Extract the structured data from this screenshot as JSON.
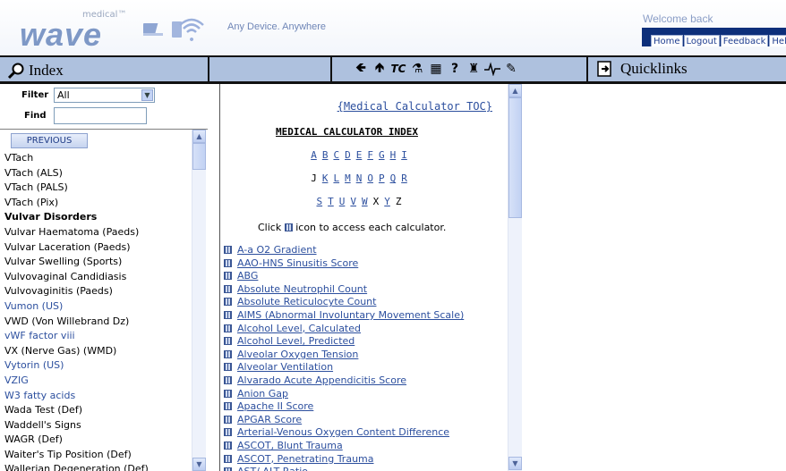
{
  "header": {
    "logo_small": "medical™",
    "logo_main": "wave",
    "tagline": "Any Device. Anywhere",
    "welcome": "Welcome back",
    "links": [
      "Home",
      "Logout",
      "Feedback",
      "Help"
    ]
  },
  "bar": {
    "index_title": "Index",
    "quicklinks_title": "Quicklinks",
    "toolbar_icons": [
      "back-arrow-icon",
      "up-arrow-icon",
      "tc-icon",
      "flask-icon",
      "calculator-icon",
      "help-icon",
      "chess-piece-icon",
      "heartbeat-icon",
      "pencil-icon"
    ]
  },
  "filter": {
    "filter_label": "Filter",
    "filter_value": "All",
    "find_label": "Find",
    "find_value": ""
  },
  "list": {
    "previous_label": "PREVIOUS",
    "items": [
      {
        "text": "VTach",
        "style": "normal"
      },
      {
        "text": "VTach (ALS)",
        "style": "normal"
      },
      {
        "text": "VTach (PALS)",
        "style": "normal"
      },
      {
        "text": "VTach (Pix)",
        "style": "normal"
      },
      {
        "text": "Vulvar Disorders",
        "style": "bold"
      },
      {
        "text": "Vulvar Haematoma (Paeds)",
        "style": "normal"
      },
      {
        "text": "Vulvar Laceration (Paeds)",
        "style": "normal"
      },
      {
        "text": "Vulvar Swelling (Sports)",
        "style": "normal"
      },
      {
        "text": "Vulvovaginal Candidiasis",
        "style": "normal"
      },
      {
        "text": "Vulvovaginitis (Paeds)",
        "style": "normal"
      },
      {
        "text": "Vumon (US)",
        "style": "blue"
      },
      {
        "text": "VWD (Von Willebrand Dz)",
        "style": "normal"
      },
      {
        "text": "vWF factor viii",
        "style": "blue"
      },
      {
        "text": "VX (Nerve Gas) (WMD)",
        "style": "normal"
      },
      {
        "text": "Vytorin (US)",
        "style": "blue"
      },
      {
        "text": "VZIG",
        "style": "blue"
      },
      {
        "text": "W3 fatty acids",
        "style": "blue"
      },
      {
        "text": "Wada Test (Def)",
        "style": "normal"
      },
      {
        "text": "Waddell's Signs",
        "style": "normal"
      },
      {
        "text": "WAGR (Def)",
        "style": "normal"
      },
      {
        "text": "Waiter's Tip Position (Def)",
        "style": "normal"
      },
      {
        "text": "Wallerian Degeneration (Def)",
        "style": "normal"
      }
    ]
  },
  "center": {
    "toc_link": "{Medical Calculator TOC}",
    "title": "MEDICAL CALCULATOR INDEX",
    "letter_rows": [
      [
        {
          "l": "A",
          "link": true
        },
        {
          "l": "B",
          "link": true
        },
        {
          "l": "C",
          "link": true
        },
        {
          "l": "D",
          "link": true
        },
        {
          "l": "E",
          "link": true
        },
        {
          "l": "F",
          "link": true
        },
        {
          "l": "G",
          "link": true
        },
        {
          "l": "H",
          "link": true
        },
        {
          "l": "I",
          "link": true
        }
      ],
      [
        {
          "l": "J",
          "link": false
        },
        {
          "l": "K",
          "link": true
        },
        {
          "l": "L",
          "link": true
        },
        {
          "l": "M",
          "link": true
        },
        {
          "l": "N",
          "link": true
        },
        {
          "l": "O",
          "link": true
        },
        {
          "l": "P",
          "link": true
        },
        {
          "l": "Q",
          "link": true
        },
        {
          "l": "R",
          "link": true
        }
      ],
      [
        {
          "l": "S",
          "link": true
        },
        {
          "l": "T",
          "link": true
        },
        {
          "l": "U",
          "link": true
        },
        {
          "l": "V",
          "link": true
        },
        {
          "l": "W",
          "link": true
        },
        {
          "l": "X",
          "link": false
        },
        {
          "l": "Y",
          "link": true
        },
        {
          "l": "Z",
          "link": false
        }
      ]
    ],
    "hint_before": "Click",
    "hint_after": "icon to access each calculator.",
    "calculators": [
      "A-a O2 Gradient",
      "AAO-HNS Sinusitis Score",
      "ABG",
      "Absolute Neutrophil Count",
      "Absolute Reticulocyte Count",
      "AIMS (Abnormal Involuntary Movement Scale)",
      "Alcohol Level, Calculated",
      "Alcohol Level, Predicted",
      "Alveolar Oxygen Tension",
      "Alveolar Ventilation",
      "Alvarado Acute Appendicitis Score",
      "Anion Gap",
      "Apache II Score",
      "APGAR Score",
      "Arterial-Venous Oxygen Content Difference",
      "ASCOT, Blunt Trauma",
      "ASCOT, Penetrating Trauma",
      "AST/ ALT Ratio"
    ]
  }
}
